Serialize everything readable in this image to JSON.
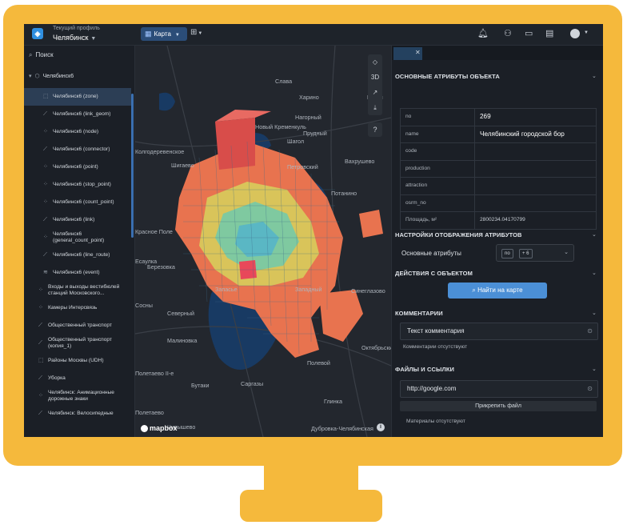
{
  "header": {
    "profile_caption": "Текущий профиль",
    "profile_name": "Челябинск",
    "map_button_label": "Карта"
  },
  "sidebar": {
    "search_label": "Поиск",
    "root_label": "Челябинск6",
    "items": [
      {
        "label": "Челябинск6 (zone)",
        "icon": "polygon-icon",
        "selected": true
      },
      {
        "label": "Челябинск6 (link_geom)",
        "icon": "line-icon"
      },
      {
        "label": "Челябинск6 (node)",
        "icon": "points-icon"
      },
      {
        "label": "Челябинск6 (connector)",
        "icon": "line-icon"
      },
      {
        "label": "Челябинск6 (point)",
        "icon": "points-icon"
      },
      {
        "label": "Челябинск6 (stop_point)",
        "icon": "points-icon"
      },
      {
        "label": "Челябинск6 (count_point)",
        "icon": "points-icon"
      },
      {
        "label": "Челябинск6 (link)",
        "icon": "line-icon"
      },
      {
        "label": "Челябинск6 (general_count_point)",
        "icon": "points-icon"
      },
      {
        "label": "Челябинск6 (line_route)",
        "icon": "line-icon"
      },
      {
        "label": "Челябинск6 (event)",
        "icon": "layers-icon"
      },
      {
        "label": "Входы и выходы вестибюлей станций Московского...",
        "icon": "points-icon"
      },
      {
        "label": "Камеры Интерсвязь",
        "icon": "points-icon"
      },
      {
        "label": "Общественный транспорт",
        "icon": "line-icon"
      },
      {
        "label": "Общественный транспорт (копия_1)",
        "icon": "line-icon"
      },
      {
        "label": "Районы Москвы (UDH)",
        "icon": "polygon-icon"
      },
      {
        "label": "Уборка",
        "icon": "line-icon"
      },
      {
        "label": "Челябинск: Анимационные дорожные знаки",
        "icon": "points-icon"
      },
      {
        "label": "Челябинск: Велосипедные",
        "icon": "line-icon"
      }
    ]
  },
  "map": {
    "places": [
      "Слава",
      "Харино",
      "Ершы",
      "Нагорный",
      "Новый Кременкуль",
      "Прудный",
      "Шагол",
      "Колгодеревенское",
      "Шигаево",
      "Петровский",
      "Вахрушево",
      "Потанино",
      "Красное Поле",
      "Есаулка",
      "Березовка",
      "Синеглазово",
      "Малиновка",
      "Западный",
      "Запасье",
      "Сосны",
      "Северный",
      "Октябрьский",
      "Полевой",
      "Полетаево II-е",
      "Бутаки",
      "Саргазы",
      "Полетаево",
      "Чипышево",
      "Глинка",
      "Дубровка-Челябинская"
    ],
    "attribution": "mapbox",
    "tool_icons": [
      "layers-icon",
      "3d-toggle",
      "compass-icon",
      "download-icon"
    ],
    "tool_3d_label": "3D"
  },
  "panel": {
    "basic_title": "ОСНОВНЫЕ АТРИБУТЫ ОБЪЕКТА",
    "attributes": [
      {
        "key": "no",
        "value": "269"
      },
      {
        "key": "name",
        "value": "Челябинский городской бор"
      },
      {
        "key": "code",
        "value": ""
      },
      {
        "key": "production",
        "value": ""
      },
      {
        "key": "attraction",
        "value": ""
      },
      {
        "key": "osrm_no",
        "value": ""
      },
      {
        "key": "Площадь, м²",
        "value": "2800234.04170799"
      }
    ],
    "display_title": "НАСТРОЙКИ ОТОБРАЖЕНИЯ АТРИБУТОВ",
    "display_label": "Основные атрибуты",
    "display_chips": [
      "no",
      "+ 6"
    ],
    "actions_title": "ДЕЙСТВИЯ С ОБЪЕКТОМ",
    "find_button": "Найти на карте",
    "comments_title": "КОММЕНТАРИИ",
    "comment_input": "Текст комментария",
    "comments_empty": "Комментарии отсутствуют",
    "files_title": "ФАЙЛЫ И ССЫЛКИ",
    "link_input": "http://google.com",
    "attach_button": "Прикрепить файл",
    "files_empty": "Материалы отсутствуют"
  }
}
